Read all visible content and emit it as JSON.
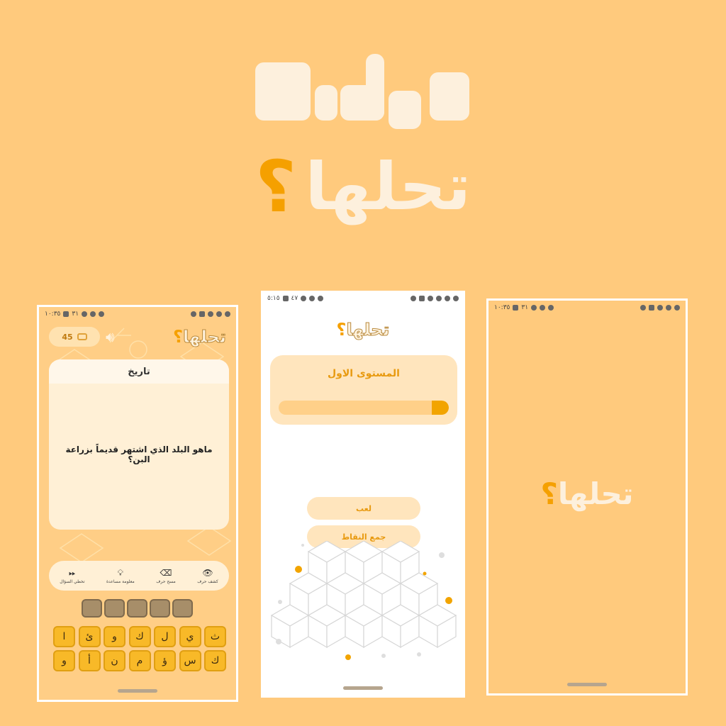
{
  "hero": {
    "logo_word": "تحلها",
    "logo_mark": "؟"
  },
  "question_screen": {
    "status_time": "١٠:٣٥",
    "status_battery": "٣١",
    "coins": "45",
    "category": "تاريخ",
    "question": "ماهو البلد الذي اشتهر قديماً بزراعة البن؟",
    "helpers": [
      {
        "icon": "eye-icon",
        "label": "كشف حرف"
      },
      {
        "icon": "eraser-icon",
        "label": "مسح حرف"
      },
      {
        "icon": "lightbulb-icon",
        "label": "معلومة مساعدة"
      },
      {
        "icon": "fast-forward-icon",
        "label": "تخطي السؤال"
      }
    ],
    "answer_slots": 5,
    "keyboard_rows": [
      [
        "ث",
        "ي",
        "ل",
        "ك",
        "و",
        "ئ",
        "ا"
      ],
      [
        "ك",
        "س",
        "ؤ",
        "م",
        "ن",
        "أ",
        "و"
      ]
    ]
  },
  "level_screen": {
    "status_time": "٥:١٥",
    "status_battery": "٤٧",
    "level_title": "المستوى الاول",
    "progress": 0.1,
    "play_label": "لعب",
    "collect_points_label": "جمع النقاط"
  },
  "splash_screen": {
    "status_time": "١٠:٣٥",
    "status_battery": "٣١"
  },
  "colors": {
    "background": "#ffca7d",
    "accent": "#f5a000",
    "cream": "#fdf0dd",
    "key": "#f8b928"
  }
}
